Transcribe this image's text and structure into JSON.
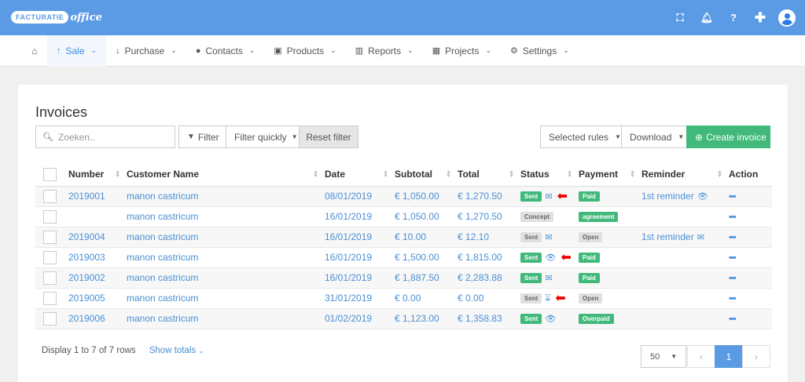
{
  "brand": {
    "logo_part1": "FACTURATIE",
    "logo_part2": "office"
  },
  "topbar": {
    "icons": [
      "fullscreen-icon",
      "bell-icon",
      "help-icon",
      "plus-icon",
      "user-avatar-icon"
    ]
  },
  "nav": {
    "items": [
      {
        "label": "Sale",
        "icon": "↑"
      },
      {
        "label": "Purchase",
        "icon": "↓"
      },
      {
        "label": "Contacts",
        "icon": "👤"
      },
      {
        "label": "Products",
        "icon": "🛒"
      },
      {
        "label": "Reports",
        "icon": "📊"
      },
      {
        "label": "Projects",
        "icon": "📅"
      },
      {
        "label": "Settings",
        "icon": "⚙"
      }
    ]
  },
  "page": {
    "title": "Invoices",
    "search_placeholder": "Zoeken..",
    "filter_label": "Filter",
    "filter_quickly_label": "Filter quickly",
    "reset_filter_label": "Reset filter",
    "selected_rules_label": "Selected rules",
    "download_label": "Download",
    "create_invoice_label": "Create invoice"
  },
  "table": {
    "headers": {
      "number": "Number",
      "customer": "Customer Name",
      "date": "Date",
      "subtotal": "Subtotal",
      "total": "Total",
      "status": "Status",
      "payment": "Payment",
      "reminder": "Reminder",
      "action": "Action"
    },
    "rows": [
      {
        "number": "2019001",
        "customer": "manon castricum",
        "date": "08/01/2019",
        "subtotal": "€ 1,050.00",
        "total": "€ 1,270.50",
        "status": "Sent",
        "payment": "Paid",
        "reminder": "1st reminder"
      },
      {
        "number": "",
        "customer": "manon castricum",
        "date": "16/01/2019",
        "subtotal": "€ 1,050.00",
        "total": "€ 1,270.50",
        "status": "Concept",
        "payment": "agreement",
        "reminder": ""
      },
      {
        "number": "2019004",
        "customer": "manon castricum",
        "date": "16/01/2019",
        "subtotal": "€ 10.00",
        "total": "€ 12.10",
        "status": "Sent",
        "payment": "Open",
        "reminder": "1st reminder"
      },
      {
        "number": "2019003",
        "customer": "manon castricum",
        "date": "16/01/2019",
        "subtotal": "€ 1,500.00",
        "total": "€ 1,815.00",
        "status": "Sent",
        "payment": "Paid",
        "reminder": ""
      },
      {
        "number": "2019002",
        "customer": "manon castricum",
        "date": "16/01/2019",
        "subtotal": "€ 1,887.50",
        "total": "€ 2,283.88",
        "status": "Sent",
        "payment": "Paid",
        "reminder": ""
      },
      {
        "number": "2019005",
        "customer": "manon castricum",
        "date": "31/01/2019",
        "subtotal": "€ 0.00",
        "total": "€ 0.00",
        "status": "Sent",
        "payment": "Open",
        "reminder": ""
      },
      {
        "number": "2019006",
        "customer": "manon castricum",
        "date": "01/02/2019",
        "subtotal": "€ 1,123.00",
        "total": "€ 1,358.83",
        "status": "Sent",
        "payment": "Overpaid",
        "reminder": ""
      }
    ]
  },
  "footer": {
    "display_text": "Display 1 to 7 of 7 rows",
    "show_totals": "Show totals",
    "per_page": "50",
    "prev": "‹",
    "current_page": "1",
    "next": "›"
  },
  "colors": {
    "topbar": "#5b9be5",
    "accent": "#4a8fd4",
    "green": "#40b97a",
    "arrow": "#e00000"
  }
}
